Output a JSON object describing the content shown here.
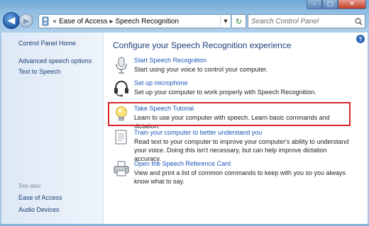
{
  "titlebar": {
    "controls": {
      "minimize": "–",
      "maximize": "□",
      "close": "✕"
    }
  },
  "address": {
    "icon": "control-panel-icon",
    "chevron": "«",
    "crumbs": [
      "Ease of Access",
      "Speech Recognition"
    ],
    "separator": "▸"
  },
  "search": {
    "placeholder": "Search Control Panel"
  },
  "sidebar": {
    "home": "Control Panel Home",
    "links": [
      "Advanced speech options",
      "Text to Speech"
    ],
    "see_also": "See also",
    "see_also_links": [
      "Ease of Access",
      "Audio Devices"
    ]
  },
  "main": {
    "title": "Configure your Speech Recognition experience",
    "items": [
      {
        "icon": "microphone-icon",
        "link": "Start Speech Recognition",
        "desc": "Start using your voice to control your computer."
      },
      {
        "icon": "headset-icon",
        "link": "Set up microphone",
        "desc": "Set up your computer to work properly with Speech Recognition."
      },
      {
        "icon": "lightbulb-icon",
        "link": "Take Speech Tutorial",
        "desc": "Learn to use your computer with speech.  Learn basic commands and dictation."
      },
      {
        "icon": "document-icon",
        "link": "Train your computer to better understand you",
        "desc": "Read text to your computer to improve your computer's ability to understand your voice.  Doing this isn't necessary, but can help improve dictation accuracy."
      },
      {
        "icon": "printer-icon",
        "link": "Open the Speech Reference Card",
        "desc": "View and print a list of common commands to keep with you so you always know what to say."
      }
    ]
  },
  "colors": {
    "highlight_border": "#d8232a",
    "link": "#1a56b8",
    "title": "#1c3f7a"
  }
}
